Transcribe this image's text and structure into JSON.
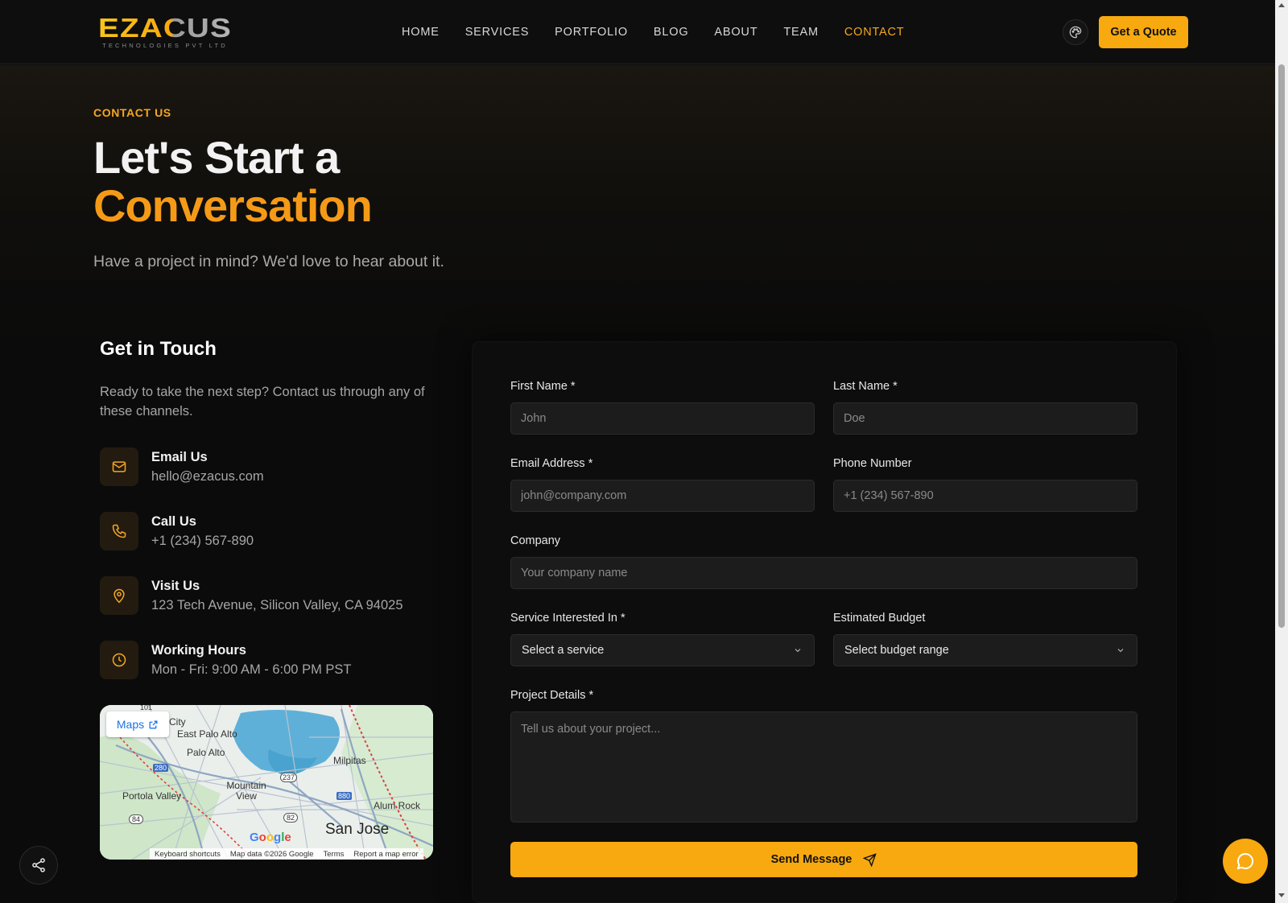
{
  "brand": {
    "logo_text": "EZACUS",
    "logo_subtext": "TECHNOLOGIES PVT LTD",
    "accent": "#f7a90f",
    "orange": "#f59a17"
  },
  "nav": {
    "items": [
      {
        "label": "HOME"
      },
      {
        "label": "SERVICES"
      },
      {
        "label": "PORTFOLIO"
      },
      {
        "label": "BLOG"
      },
      {
        "label": "ABOUT"
      },
      {
        "label": "TEAM"
      },
      {
        "label": "CONTACT",
        "active": true
      }
    ],
    "theme_icon": "palette-icon",
    "quote_label": "Get a Quote"
  },
  "hero": {
    "eyebrow": "CONTACT US",
    "title_line1": "Let's Start a",
    "title_line2": "Conversation",
    "subtitle": "Have a project in mind? We'd love to hear about it."
  },
  "contact_info": {
    "title": "Get in Touch",
    "description": "Ready to take the next step? Contact us through any of these channels.",
    "items": [
      {
        "icon": "mail-icon",
        "label": "Email Us",
        "value": "hello@ezacus.com"
      },
      {
        "icon": "phone-icon",
        "label": "Call Us",
        "value": "+1 (234) 567-890"
      },
      {
        "icon": "map-pin-icon",
        "label": "Visit Us",
        "value": "123 Tech Avenue, Silicon Valley, CA 94025"
      },
      {
        "icon": "clock-icon",
        "label": "Working Hours",
        "value": "Mon - Fri: 9:00 AM - 6:00 PM PST"
      }
    ]
  },
  "map": {
    "button_label": "Maps",
    "places": [
      "City",
      "East Palo Alto",
      "Palo Alto",
      "Milpitas",
      "Mountain View",
      "Portola Valley",
      "Alum Rock",
      "San Jose"
    ],
    "route_shields": [
      "101",
      "280",
      "237",
      "880",
      "82",
      "84"
    ],
    "logo": "Google",
    "footer": [
      "Keyboard shortcuts",
      "Map data ©2026 Google",
      "Terms",
      "Report a map error"
    ]
  },
  "form": {
    "first_name": {
      "label": "First Name *",
      "placeholder": "John"
    },
    "last_name": {
      "label": "Last Name *",
      "placeholder": "Doe"
    },
    "email": {
      "label": "Email Address *",
      "placeholder": "john@company.com"
    },
    "phone": {
      "label": "Phone Number",
      "placeholder": "+1 (234) 567-890"
    },
    "company": {
      "label": "Company",
      "placeholder": "Your company name"
    },
    "service": {
      "label": "Service Interested In *",
      "selected": "Select a service"
    },
    "budget": {
      "label": "Estimated Budget",
      "selected": "Select budget range"
    },
    "details": {
      "label": "Project Details *",
      "placeholder": "Tell us about your project..."
    },
    "submit_label": "Send Message"
  },
  "floating": {
    "share_icon": "share-icon",
    "chat_icon": "chat-bubble-icon"
  }
}
